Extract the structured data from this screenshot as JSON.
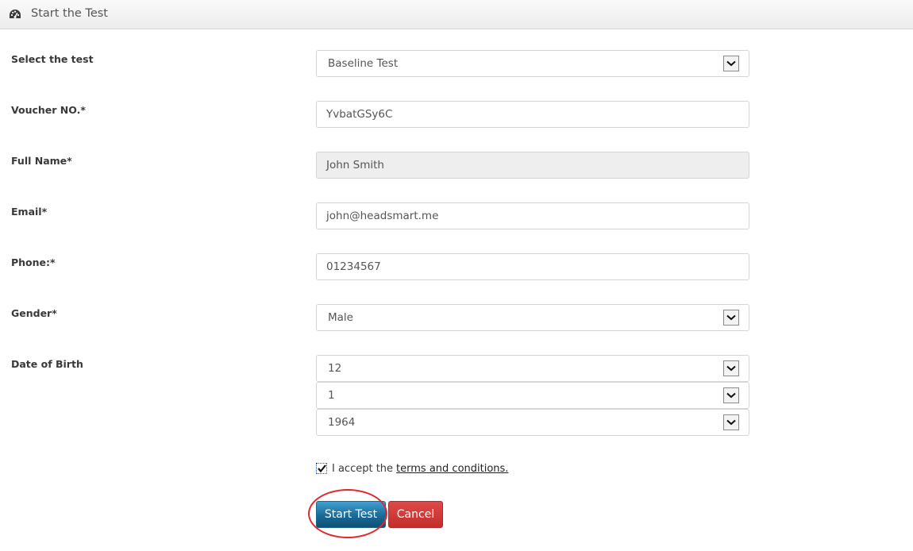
{
  "header": {
    "icon": "dashboard-gauge-icon",
    "title": "Start the Test"
  },
  "form": {
    "test": {
      "label": "Select the test",
      "value": "Baseline Test",
      "type": "select"
    },
    "voucher": {
      "label": "Voucher NO.*",
      "value": "YvbatGSy6C",
      "type": "text"
    },
    "full_name": {
      "label": "Full Name*",
      "value": "John Smith",
      "type": "text",
      "disabled": true
    },
    "email": {
      "label": "Email*",
      "value": "john@headsmart.me",
      "type": "text"
    },
    "phone": {
      "label": "Phone:*",
      "value": "01234567",
      "type": "text"
    },
    "gender": {
      "label": "Gender*",
      "value": "Male",
      "type": "select"
    },
    "dob": {
      "label": "Date of Birth",
      "day": "12",
      "month": "1",
      "year": "1964"
    },
    "terms": {
      "checked": true,
      "prefix": "I accept the",
      "link_text": "terms and conditions."
    }
  },
  "actions": {
    "start_label": "Start Test",
    "cancel_label": "Cancel",
    "start_color": "#1a6a96",
    "cancel_color": "#c9302c",
    "highlight_color": "#e3262b"
  }
}
